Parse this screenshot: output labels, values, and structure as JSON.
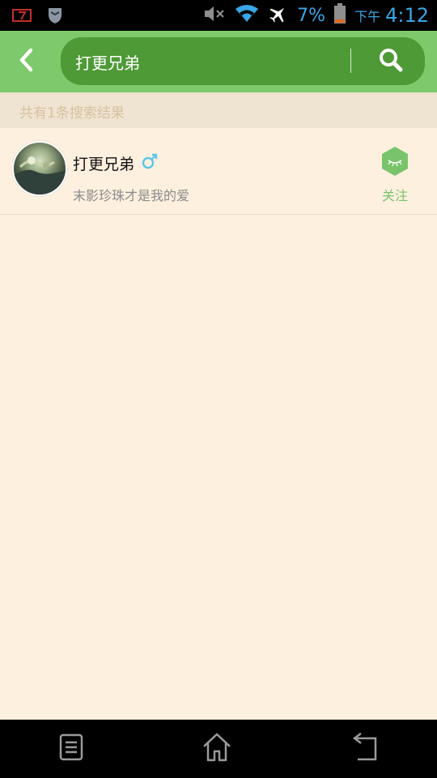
{
  "status_bar": {
    "battery_percent": "7%",
    "ampm": "下午",
    "time": "4:12"
  },
  "header": {
    "search_value": "打更兄弟"
  },
  "results": {
    "count_text": "共有1条搜索结果",
    "items": [
      {
        "name": "打更兄弟",
        "signature": "末影珍珠才是我的爱",
        "follow_label": "关注"
      }
    ]
  },
  "colors": {
    "header_bg": "#7ec96b",
    "search_bg": "#4e9a37",
    "page_bg": "#fdf0df",
    "accent_green": "#79c46a",
    "status_blue": "#3aa6e8",
    "gender_male": "#5cc6e8"
  }
}
